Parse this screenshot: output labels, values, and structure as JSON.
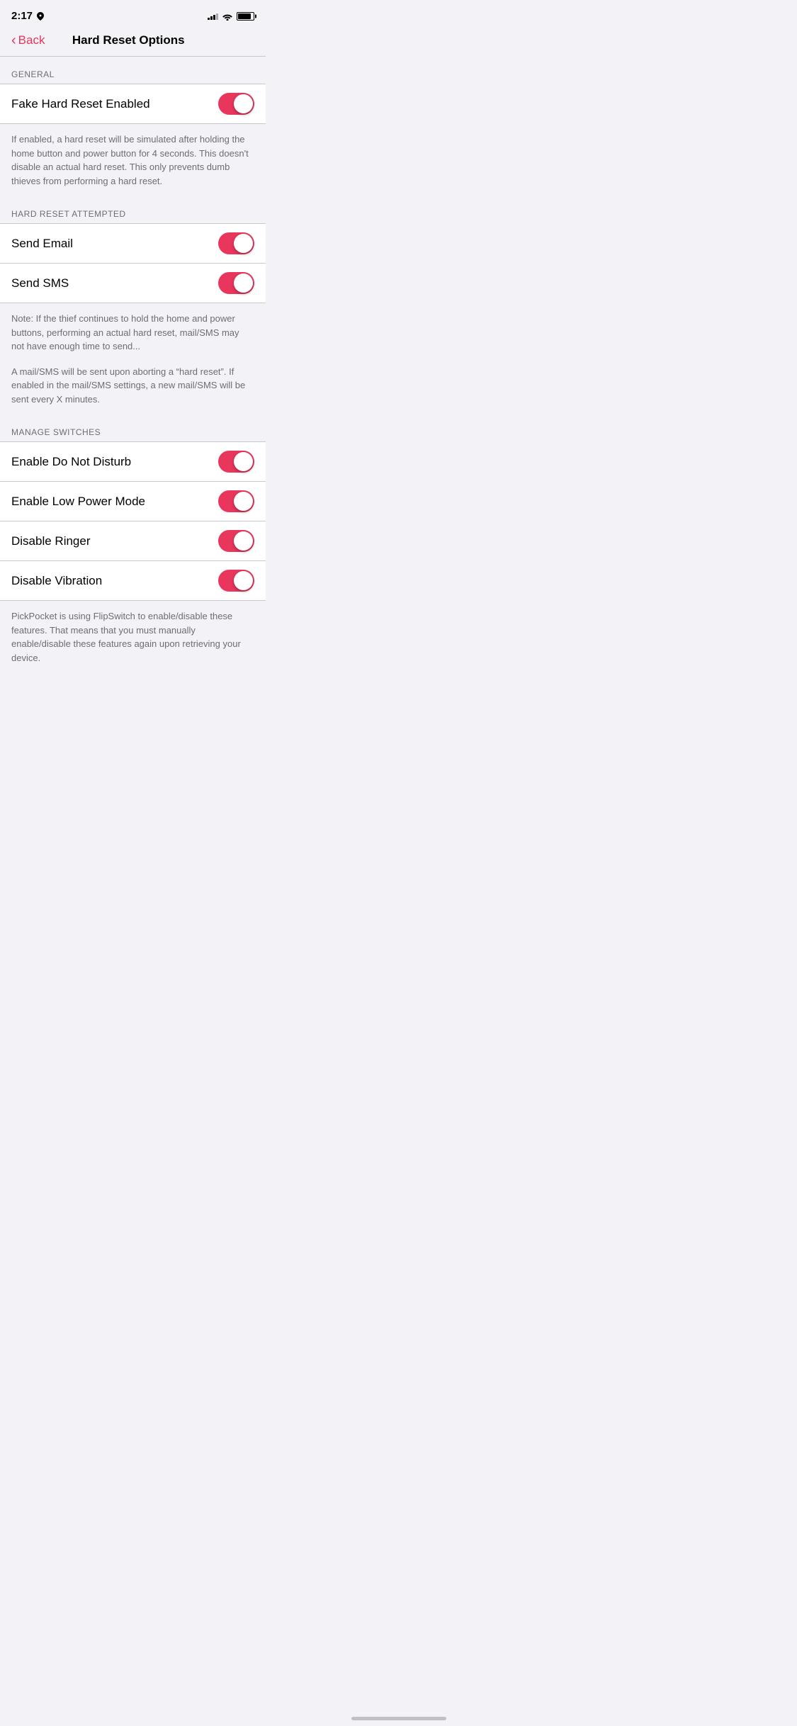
{
  "statusBar": {
    "time": "2:17",
    "locationIcon": "◁",
    "signalBars": [
      3,
      5,
      7,
      9,
      11
    ],
    "signalActive": 3,
    "batteryPercent": 85
  },
  "nav": {
    "backLabel": "Back",
    "title": "Hard Reset Options"
  },
  "sections": [
    {
      "id": "general",
      "header": "GENERAL",
      "rows": [
        {
          "id": "fake-hard-reset",
          "label": "Fake Hard Reset Enabled",
          "toggleOn": true
        }
      ],
      "description": "If enabled, a hard reset will be simulated after holding the home button and power button for 4 seconds. This doesn't disable an actual hard reset. This only prevents dumb thieves from performing a hard reset."
    },
    {
      "id": "hard-reset-attempted",
      "header": "HARD RESET ATTEMPTED",
      "rows": [
        {
          "id": "send-email",
          "label": "Send Email",
          "toggleOn": true
        },
        {
          "id": "send-sms",
          "label": "Send SMS",
          "toggleOn": true
        }
      ],
      "description1": "Note: If the thief continues to hold the home and power buttons, performing an actual hard reset, mail/SMS may not have enough time to send...",
      "description2": "A mail/SMS will be sent upon aborting a “hard reset”. If enabled in the mail/SMS settings, a new mail/SMS will be sent every X minutes."
    },
    {
      "id": "manage-switches",
      "header": "MANAGE SWITCHES",
      "rows": [
        {
          "id": "enable-do-not-disturb",
          "label": "Enable Do Not Disturb",
          "toggleOn": true
        },
        {
          "id": "enable-low-power-mode",
          "label": "Enable Low Power Mode",
          "toggleOn": true
        },
        {
          "id": "disable-ringer",
          "label": "Disable Ringer",
          "toggleOn": true
        },
        {
          "id": "disable-vibration",
          "label": "Disable Vibration",
          "toggleOn": true
        }
      ],
      "description": "PickPocket is using FlipSwitch to enable/disable these features. That means that you must manually enable/disable these features again upon retrieving your device."
    }
  ]
}
